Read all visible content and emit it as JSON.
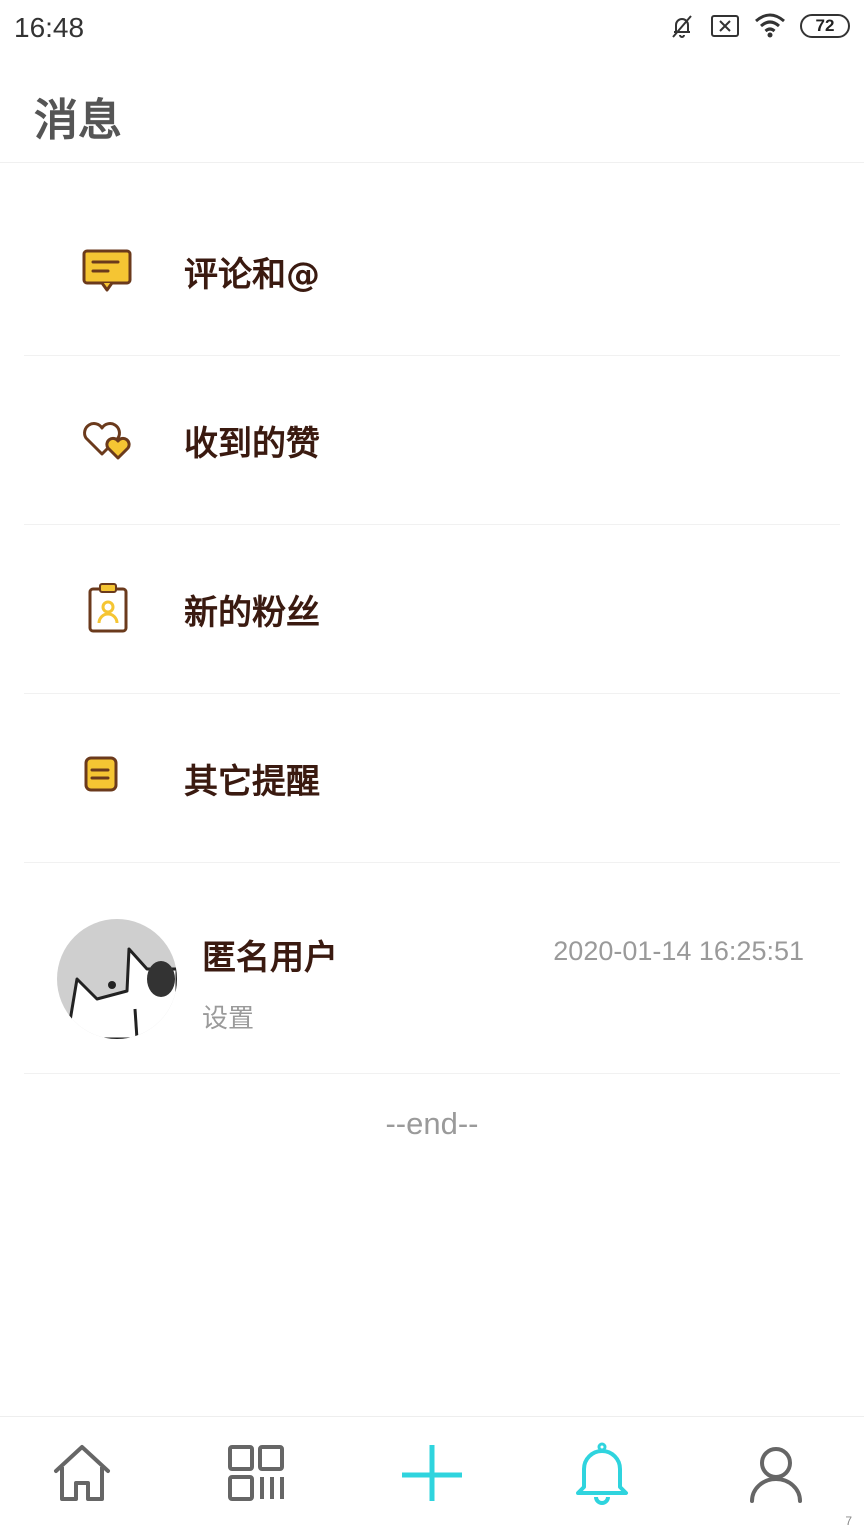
{
  "status_bar": {
    "time": "16:48",
    "battery": "72",
    "icons": [
      "mute-bell-icon",
      "sim-x-icon",
      "wifi-icon",
      "battery-icon"
    ]
  },
  "header": {
    "title": "消息"
  },
  "menu": {
    "items": [
      {
        "label": "评论和@",
        "icon": "comment-icon"
      },
      {
        "label": "收到的赞",
        "icon": "hearts-icon"
      },
      {
        "label": "新的粉丝",
        "icon": "fan-badge-icon"
      },
      {
        "label": "其它提醒",
        "icon": "note-icon"
      }
    ]
  },
  "conversation": {
    "name": "匿名用户",
    "time": "2020-01-14 16:25:51",
    "preview": "设置"
  },
  "list_end": "--end--",
  "tabbar": {
    "tabs": [
      "home-icon",
      "grid-icon",
      "plus-icon",
      "bell-icon",
      "profile-icon"
    ],
    "active_color": "#2fd4de",
    "inactive_color": "#666666"
  },
  "accent": {
    "icon_yellow": "#f5c533",
    "icon_brown": "#6b3a1c"
  },
  "corner_mark": "7"
}
